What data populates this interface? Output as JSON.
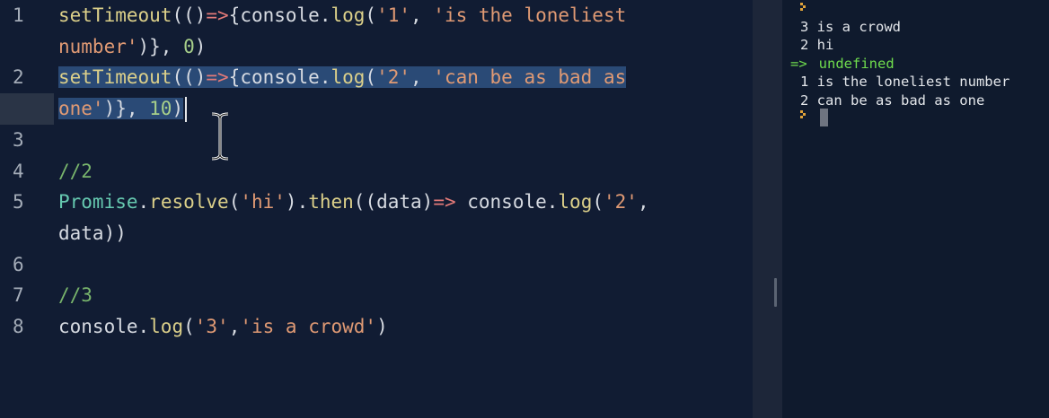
{
  "editor": {
    "lines": [
      {
        "num": "1",
        "parts": [
          [
            "fn",
            "setTimeout"
          ],
          [
            "p",
            "(()"
          ],
          [
            "arrow",
            "=>"
          ],
          [
            "p",
            "{console."
          ],
          [
            "fn",
            "log"
          ],
          [
            "p",
            "("
          ],
          [
            "str",
            "'1'"
          ],
          [
            "p",
            ", "
          ],
          [
            "str",
            "'is the loneliest"
          ]
        ]
      },
      {
        "num": "",
        "parts": [
          [
            "str",
            "number'"
          ],
          [
            "p",
            ")}, "
          ],
          [
            "num",
            "0"
          ],
          [
            "p",
            ")"
          ]
        ]
      },
      {
        "num": "2",
        "sel": true,
        "parts": [
          [
            "fn",
            "setTimeout"
          ],
          [
            "p",
            "(()"
          ],
          [
            "arrow",
            "=>"
          ],
          [
            "p",
            "{console."
          ],
          [
            "fn",
            "log"
          ],
          [
            "p",
            "("
          ],
          [
            "str",
            "'2'"
          ],
          [
            "p",
            ", "
          ],
          [
            "str",
            "'can be as bad as"
          ]
        ]
      },
      {
        "num": "",
        "sel": true,
        "caret": true,
        "parts": [
          [
            "str",
            "one'"
          ],
          [
            "p",
            ")}, "
          ],
          [
            "num",
            "10"
          ],
          [
            "p",
            ")"
          ]
        ]
      },
      {
        "num": "3",
        "parts": []
      },
      {
        "num": "4",
        "parts": [
          [
            "cmt",
            "//2"
          ]
        ]
      },
      {
        "num": "5",
        "parts": [
          [
            "cls",
            "Promise"
          ],
          [
            "p",
            "."
          ],
          [
            "fn",
            "resolve"
          ],
          [
            "p",
            "("
          ],
          [
            "str",
            "'hi'"
          ],
          [
            "p",
            ")."
          ],
          [
            "fn",
            "then"
          ],
          [
            "p",
            "((data)"
          ],
          [
            "arrow",
            "=>"
          ],
          [
            "p",
            " console."
          ],
          [
            "fn",
            "log"
          ],
          [
            "p",
            "("
          ],
          [
            "str",
            "'2'"
          ],
          [
            "p",
            ","
          ]
        ]
      },
      {
        "num": "",
        "parts": [
          [
            "p",
            "data))"
          ]
        ]
      },
      {
        "num": "6",
        "parts": []
      },
      {
        "num": "7",
        "parts": [
          [
            "cmt",
            "//3"
          ]
        ]
      },
      {
        "num": "8",
        "parts": [
          [
            "p",
            "console."
          ],
          [
            "fn",
            "log"
          ],
          [
            "p",
            "("
          ],
          [
            "str",
            "'3'"
          ],
          [
            "p",
            ","
          ],
          [
            "str",
            "'is a crowd'"
          ],
          [
            "p",
            ")"
          ]
        ]
      }
    ]
  },
  "console": {
    "lines": [
      {
        "kind": "prompt",
        "text": ""
      },
      {
        "kind": "out",
        "text": "3 is a crowd"
      },
      {
        "kind": "out",
        "text": "2 hi"
      },
      {
        "kind": "result",
        "arrow": "=>",
        "text": "undefined"
      },
      {
        "kind": "out",
        "text": "1 is the loneliest number"
      },
      {
        "kind": "out",
        "text": "2 can be as bad as one"
      },
      {
        "kind": "prompt",
        "text": ""
      }
    ]
  }
}
